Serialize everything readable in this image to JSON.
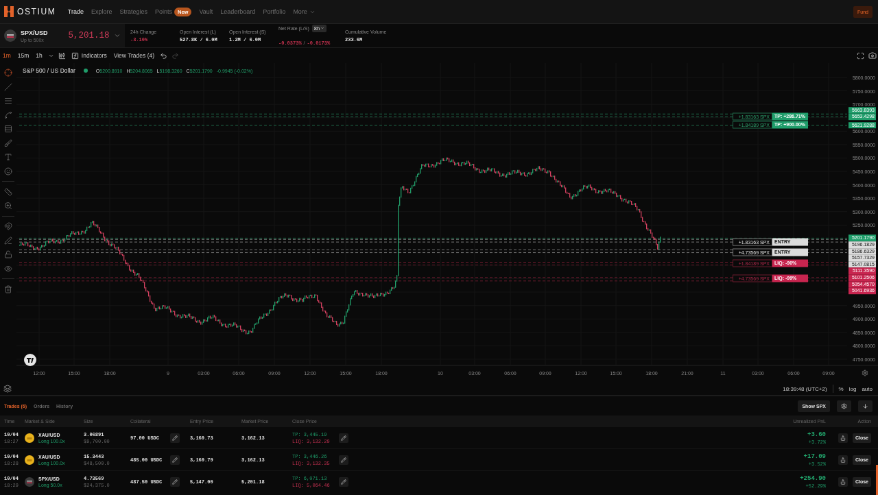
{
  "nav": {
    "logo": "OSTIUM",
    "items": [
      {
        "label": "Trade",
        "selected": true,
        "dropdown": false
      },
      {
        "label": "Explore",
        "selected": false,
        "dropdown": false
      },
      {
        "label": "Strategies",
        "selected": false,
        "dropdown": false
      },
      {
        "label": "Points",
        "selected": false,
        "dropdown": false,
        "badge": "New"
      },
      {
        "label": "Vault",
        "selected": false,
        "dropdown": false
      },
      {
        "label": "Leaderboard",
        "selected": false,
        "dropdown": false
      },
      {
        "label": "Portfolio",
        "selected": false,
        "dropdown": false
      },
      {
        "label": "More",
        "selected": false,
        "dropdown": true
      }
    ],
    "fund_button": "Fund"
  },
  "market": {
    "pair": "SPX/USD",
    "leverage": "Up to 500x",
    "price": "5,201.18",
    "stats": [
      {
        "kind": "plain",
        "label": "24h Change",
        "value": "-3.10%",
        "negative": true
      },
      {
        "kind": "plain",
        "label": "Open Interest (L)",
        "value": "527.8K / 6.0M",
        "negative": false
      },
      {
        "kind": "plain",
        "label": "Open Interest (S)",
        "value": "1.2M / 6.0M",
        "negative": false
      },
      {
        "kind": "rate",
        "label": "Net Rate (L/S)",
        "period": "8h",
        "values": [
          "-0.0373%",
          "-0.0173%"
        ],
        "separator": "/",
        "negative": true
      },
      {
        "kind": "plain",
        "label": "Cumulative Volume",
        "value": "233.6M",
        "negative": false
      }
    ]
  },
  "chart_toolbar": {
    "timeframes": [
      {
        "label": "1m",
        "selected": true
      },
      {
        "label": "15m",
        "selected": false
      },
      {
        "label": "1h",
        "selected": false
      }
    ],
    "indicators": "Indicators",
    "view_trades": "View Trades (4)"
  },
  "chart": {
    "title": "S&P 500 / US Dollar",
    "ohlc": [
      {
        "key": "O",
        "value": "5200.8910"
      },
      {
        "key": "H",
        "value": "5204.8065"
      },
      {
        "key": "L",
        "value": "5198.3260"
      },
      {
        "key": "C",
        "value": "5201.1790"
      }
    ],
    "change": "-0.9945 (-0.02%)",
    "price_ticks": [
      "5800.0000",
      "5750.0000",
      "5700.0000",
      "5600.0000",
      "5550.0000",
      "5500.0000",
      "5450.0000",
      "5400.0000",
      "5350.0000",
      "5300.0000",
      "5250.0000",
      "4950.0000",
      "4900.0000",
      "4850.0000",
      "4800.0000",
      "4750.0000"
    ],
    "price_markers": [
      {
        "value": "5663.8393",
        "kind": "tp"
      },
      {
        "value": "5653.4298",
        "kind": "tp"
      },
      {
        "value": "5621.9288",
        "kind": "tp"
      },
      {
        "value": "5201.1790",
        "kind": "current"
      },
      {
        "value": "5196.1829",
        "kind": "entry"
      },
      {
        "value": "5186.6329",
        "kind": "entry"
      },
      {
        "value": "5157.7329",
        "kind": "entry"
      },
      {
        "value": "5147.0815",
        "kind": "entry"
      },
      {
        "value": "5111.3590",
        "kind": "liq"
      },
      {
        "value": "5101.2506",
        "kind": "liq"
      },
      {
        "value": "5054.4570",
        "kind": "liq"
      },
      {
        "value": "5041.6936",
        "kind": "liq"
      }
    ],
    "order_lines": [
      {
        "size": "+1.83163 SPX",
        "label": "TP: +286.71%",
        "kind": "tp"
      },
      {
        "size": "+1.84189 SPX",
        "label": "TP: +900.00%",
        "kind": "tp"
      },
      {
        "size": "+1.83163 SPX",
        "label": "ENTRY",
        "kind": "entry"
      },
      {
        "size": "+4.73569 SPX",
        "label": "ENTRY",
        "kind": "entry"
      },
      {
        "size": "+1.84189 SPX",
        "label": "LIQ: -90%",
        "kind": "liq"
      },
      {
        "size": "+4.73569 SPX",
        "label": "LIQ: -99%",
        "kind": "liq"
      }
    ],
    "time_labels": [
      "12:00",
      "15:00",
      "18:00",
      "9",
      "03:00",
      "06:00",
      "09:00",
      "12:00",
      "15:00",
      "18:00",
      "10",
      "03:00",
      "06:00",
      "09:00",
      "12:00",
      "15:00",
      "18:00",
      "21:00",
      "11",
      "03:00",
      "06:00",
      "09:00"
    ]
  },
  "chart_footer": {
    "time": "18:39:48 (UTC+2)",
    "options": [
      "%",
      "log",
      "auto"
    ]
  },
  "positions": {
    "tabs": [
      {
        "label": "Trades (6)",
        "selected": true
      },
      {
        "label": "Orders",
        "selected": false
      },
      {
        "label": "History",
        "selected": false
      }
    ],
    "show_button": "Show SPX",
    "columns": [
      "Time",
      "Market & Side",
      "Size",
      "Collateral",
      "Entry Price",
      "Market Price",
      "Close Price",
      "Unrealized PnL",
      "Action"
    ],
    "rows": [
      {
        "kind": "gold",
        "date": "10/04",
        "time": "18:27",
        "market": "XAU/USD",
        "side": "Long 100.0x",
        "size": "3.06891",
        "notional": "$9,700.00",
        "collateral": "97.00 USDC",
        "entry": "3,160.73",
        "mark": "3,162.13",
        "tp": "TP: 3,445.19",
        "liq": "LIQ: 3,132.29",
        "pnl": "+3.60",
        "pnl_pct": "+3.72%",
        "action": "Close"
      },
      {
        "kind": "gold",
        "date": "10/04",
        "time": "18:28",
        "market": "XAU/USD",
        "side": "Long 100.0x",
        "size": "15.3443",
        "notional": "$48,500.0",
        "collateral": "485.00 USDC",
        "entry": "3,160.79",
        "mark": "3,162.13",
        "tp": "TP: 3,446.26",
        "liq": "LIQ: 3,132.35",
        "pnl": "+17.09",
        "pnl_pct": "+3.52%",
        "action": "Close"
      },
      {
        "kind": "index",
        "date": "10/04",
        "time": "18:29",
        "market": "SPX/USD",
        "side": "Long 50.0x",
        "size": "4.73569",
        "notional": "$24,375.0",
        "collateral": "487.50 USDC",
        "entry": "5,147.00",
        "mark": "5,201.18",
        "tp": "TP: 6,071.13",
        "liq": "LIQ: 5,064.46",
        "pnl": "+254.90",
        "pnl_pct": "+52.29%",
        "action": "Close"
      }
    ]
  }
}
